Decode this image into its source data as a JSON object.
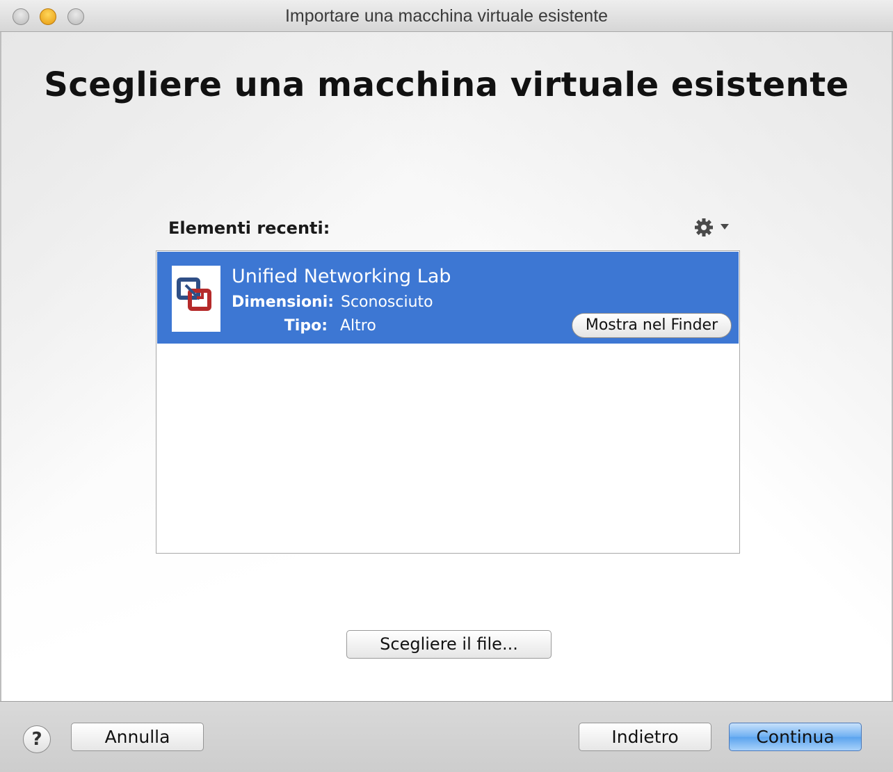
{
  "window": {
    "title": "Importare una macchina virtuale esistente"
  },
  "page": {
    "title": "Scegliere una macchina virtuale esistente"
  },
  "recent": {
    "label": "Elementi recenti:",
    "gear_menu_icon": "gear-icon",
    "items": [
      {
        "name": "Unified Networking Lab",
        "size_label": "Dimensioni:",
        "size_value": "Sconosciuto",
        "type_label": "Tipo:",
        "type_value": "Altro",
        "show_in_finder_label": "Mostra nel Finder",
        "selected": true,
        "icon": "vmware-vm-icon"
      }
    ]
  },
  "choose_file_label": "Scegliere il file...",
  "footer": {
    "help_label": "?",
    "cancel_label": "Annulla",
    "back_label": "Indietro",
    "continue_label": "Continua"
  },
  "colors": {
    "selection": "#3d77d3",
    "default_button": "#6fb0f2"
  }
}
